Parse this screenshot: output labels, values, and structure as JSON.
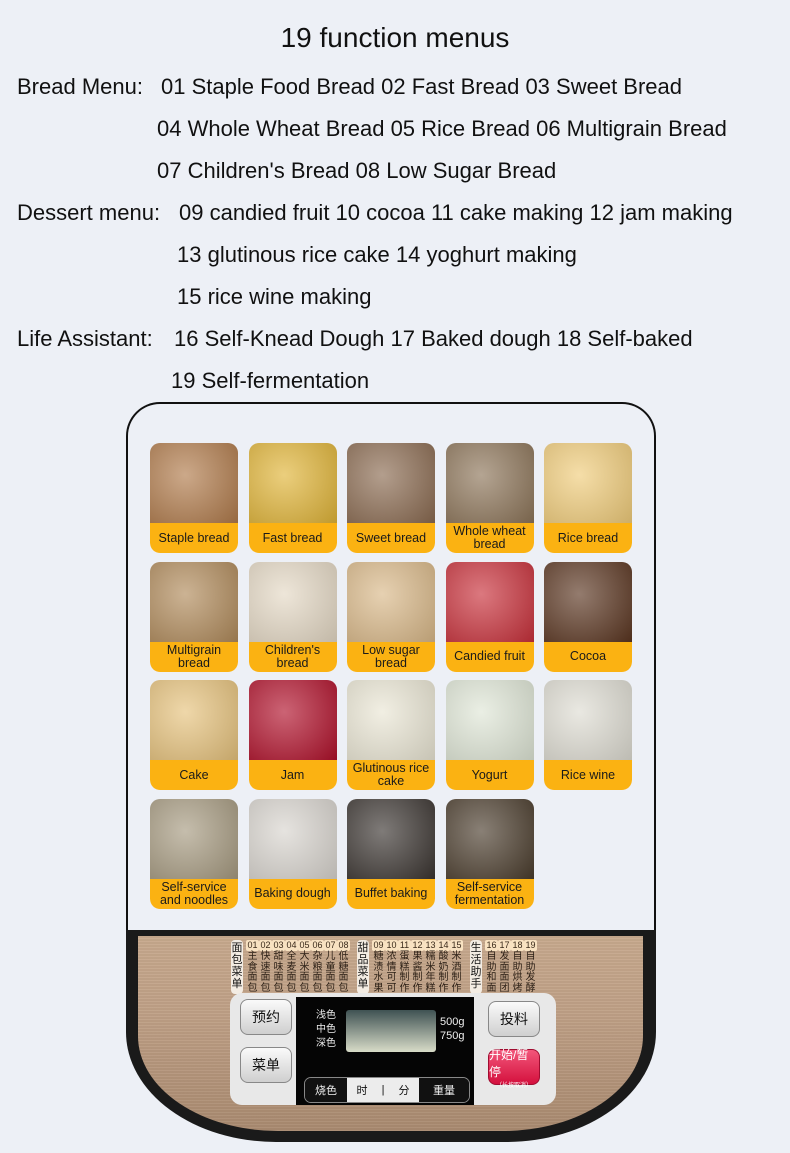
{
  "title": "19 function menus",
  "lines": {
    "bread_label": "Bread Menu:",
    "bread_1": "01 Staple Food Bread 02 Fast Bread 03 Sweet Bread",
    "bread_2": "04 Whole Wheat Bread 05 Rice Bread 06 Multigrain Bread",
    "bread_3": "07 Children's Bread 08 Low Sugar Bread",
    "dessert_label": "Dessert menu:",
    "dessert_1": "09 candied fruit 10 cocoa 11 cake making 12 jam making",
    "dessert_2": "13 glutinous rice cake 14 yoghurt making",
    "dessert_3": "15 rice wine making",
    "life_label": "Life Assistant:",
    "life_1": "16 Self-Knead Dough 17 Baked dough 18 Self-baked",
    "life_2": "19 Self-fermentation"
  },
  "tiles": [
    {
      "label": "Staple bread",
      "color": "#b07a4a"
    },
    {
      "label": "Fast bread",
      "color": "#e0b437"
    },
    {
      "label": "Sweet bread",
      "color": "#8a6a50"
    },
    {
      "label": "Whole wheat bread",
      "color": "#8c7458"
    },
    {
      "label": "Rice bread",
      "color": "#f0cc7a"
    },
    {
      "label": "Multigrain bread",
      "color": "#b08a5a"
    },
    {
      "label": "Children's bread",
      "color": "#e4d8c4"
    },
    {
      "label": "Low sugar bread",
      "color": "#d9b888"
    },
    {
      "label": "Candied fruit",
      "color": "#c8303a"
    },
    {
      "label": "Cocoa",
      "color": "#5a3520"
    },
    {
      "label": "Cake",
      "color": "#e6c27c"
    },
    {
      "label": "Jam",
      "color": "#b0102a"
    },
    {
      "label": "Glutinous rice cake",
      "color": "#eae6d4"
    },
    {
      "label": "Yogurt",
      "color": "#dfe6d6"
    },
    {
      "label": "Rice wine",
      "color": "#dedcd2"
    },
    {
      "label": "Self-service and noodles",
      "color": "#a69a80"
    },
    {
      "label": "Baking dough",
      "color": "#d8d4ce"
    },
    {
      "label": "Buffet baking",
      "color": "#3a3430"
    },
    {
      "label": "Self-service fermentation",
      "color": "#4a3c2c"
    }
  ],
  "panel": {
    "groups": [
      {
        "label": "面包菜单",
        "items": [
          {
            "num": "01",
            "text": "主食面包"
          },
          {
            "num": "02",
            "text": "快速面包"
          },
          {
            "num": "03",
            "text": "甜味面包"
          },
          {
            "num": "04",
            "text": "全麦面包"
          },
          {
            "num": "05",
            "text": "大米面包"
          },
          {
            "num": "06",
            "text": "杂粮面包"
          },
          {
            "num": "07",
            "text": "儿童面包"
          },
          {
            "num": "08",
            "text": "低糖面包"
          }
        ]
      },
      {
        "label": "甜品菜单",
        "items": [
          {
            "num": "09",
            "text": "糖渍水果"
          },
          {
            "num": "10",
            "text": "浓情可可"
          },
          {
            "num": "11",
            "text": "蛋糕制作"
          },
          {
            "num": "12",
            "text": "果酱制作"
          },
          {
            "num": "13",
            "text": "糯米年糕"
          },
          {
            "num": "14",
            "text": "酸奶制作"
          },
          {
            "num": "15",
            "text": "米酒制作"
          }
        ]
      },
      {
        "label": "生活助手",
        "items": [
          {
            "num": "16",
            "text": "自助和面"
          },
          {
            "num": "17",
            "text": "发面面团"
          },
          {
            "num": "18",
            "text": "自助烘烤"
          },
          {
            "num": "19",
            "text": "自助发酵"
          }
        ]
      }
    ],
    "buttons": {
      "reserve": "预约",
      "menu": "菜单",
      "add": "投料",
      "start": "开始/暂停",
      "start_sub": "（长按取消）"
    },
    "lcd": {
      "colors": [
        "浅色",
        "中色",
        "深色"
      ],
      "weights": [
        "500g",
        "750g"
      ]
    },
    "segments": {
      "color": "烧色",
      "hour": "时",
      "sep": "|",
      "minute": "分",
      "weight": "重量"
    }
  }
}
